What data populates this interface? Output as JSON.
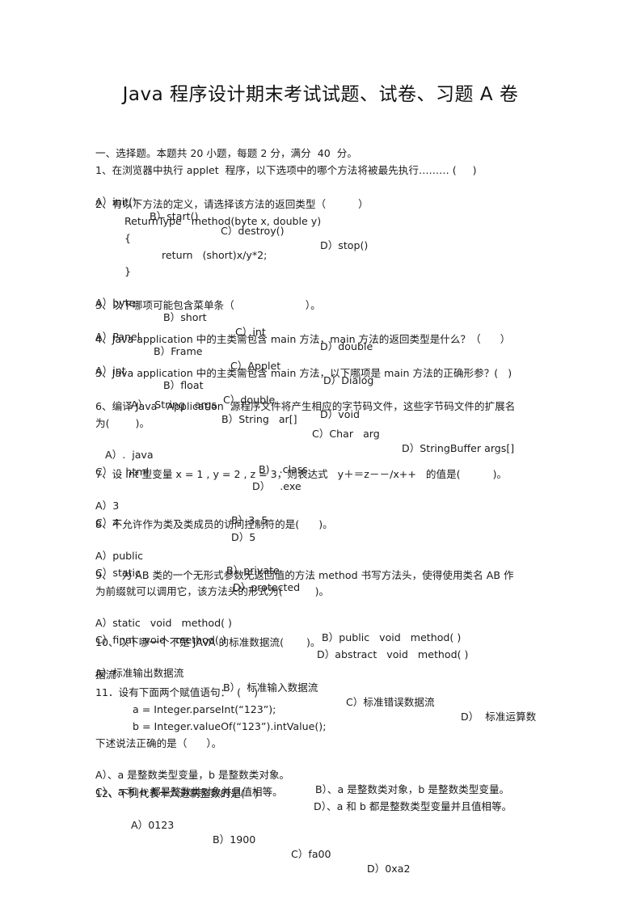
{
  "title": "Java 程序设计期末考试试题、试卷、习题 A 卷",
  "section_header": "一、选择题。本题共 20 小题，每题 2 分，满分  40  分。",
  "questions": [
    {
      "stem": "1、在浏览器中执行 applet  程序，以下选项中的哪个方法将被最先执行……… (     )",
      "options": [
        "A）init()",
        "B）start()",
        "C）destroy()",
        "D）stop()"
      ]
    },
    {
      "stem": "2、有以下方法的定义，请选择该方法的返回类型（          ）",
      "code": [
        "ReturnType   method(byte x, double y)",
        "{",
        "return   (short)x/y*2;",
        "}"
      ],
      "options": [
        "A）byte",
        "B）short",
        "C）int",
        "D）double"
      ]
    },
    {
      "stem": "3、以下哪项可能包含菜单条（                      ）。",
      "options": [
        "A）Panel",
        "B）Frame",
        "C）Applet",
        "D）Dialog"
      ]
    },
    {
      "stem": "4、Java application 中的主类需包含 main 方法，main 方法的返回类型是什么？（      ）",
      "options": [
        "A）int",
        "B）float",
        "C）double",
        "D）void"
      ]
    },
    {
      "stem": "5、Java application 中的主类需包含 main 方法，以下哪项是 main 方法的正确形参？(   )",
      "options": [
        "A）  String   args",
        "B）String   ar[]",
        "C）Char   arg",
        "D）StringBuffer args[]"
      ]
    },
    {
      "stem": "6、编译 Java   Application  源程序文件将产生相应的字节码文件，这些字节码文件的扩展名",
      "stem_cont": "为(        )。",
      "options": [
        "A）.  java",
        "B)   .class",
        "C）  . html",
        "D）   .exe"
      ]
    },
    {
      "stem": "7、设 int 型变量 x = 1 , y = 2 , z = 3，则表达式   y＋＝z－－/x++   的值是(          )。",
      "options": [
        "A）3",
        "B）3. 5",
        "C）4",
        "D）5"
      ]
    },
    {
      "stem": "8、不允许作为类及类成员的访问控制符的是(      )。",
      "options": [
        "A）public",
        "B）private",
        "C）static",
        "D）protected"
      ]
    },
    {
      "stem": "9、   为 AB 类的一个无形式参数无返回值的方法 method 书写方法头，使得使用类名 AB 作",
      "stem_cont": "为前缀就可以调用它，该方法头的形式为(          )。",
      "options": [
        "A）static   void   method( )",
        "B）public   void   method( )",
        "C）final   void   method( )",
        "D）abstract   void   method( )"
      ]
    },
    {
      "stem": "10、以下哪一个不是 JAVA 的标准数据流(       )。",
      "options": [
        "A）标准输出数据流",
        "B）  标准输入数据流",
        "C）标准错误数据流",
        "D）  标准运算数"
      ],
      "options_cont": "据流"
    },
    {
      "stem": "11．设有下面两个赋值语句：  (    )",
      "code": [
        "a = Integer.parseInt(“123”);",
        "b = Integer.valueOf(“123”).intValue();"
      ],
      "stem_after": "下述说法正确的是（      ）。",
      "options": [
        "A）、a 是整数类型变量，b 是整数类对象。",
        "B）、a 是整数类对象，b 是整数类型变量。",
        "C）、a 和 b 都是整数类对象并且值相等。",
        "D）、a 和 b 都是整数类型变量并且值相等。"
      ]
    },
    {
      "stem": "12、下列代表十六进制整数的是(   )",
      "options": [
        "A）0123",
        "B）1900",
        "C）fa00",
        "D）0xa2"
      ]
    }
  ]
}
